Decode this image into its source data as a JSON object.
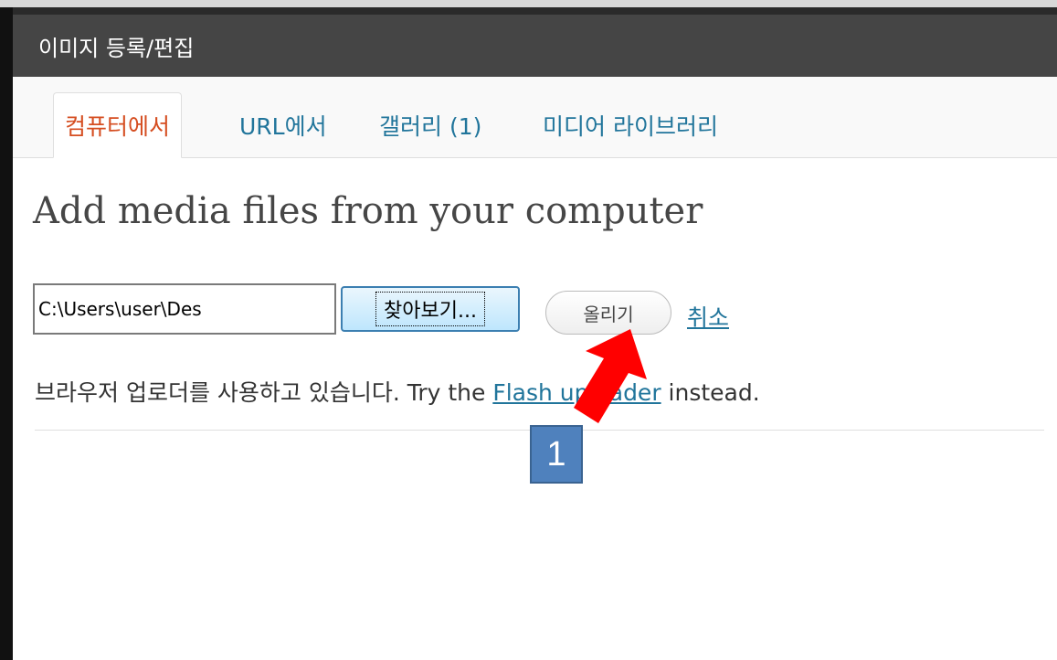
{
  "dialog": {
    "title": "이미지 등록/편집"
  },
  "tabs": [
    {
      "label": "컴퓨터에서",
      "active": true
    },
    {
      "label": "URL에서"
    },
    {
      "label": "갤러리 (1)"
    },
    {
      "label": "미디어 라이브러리"
    }
  ],
  "main": {
    "heading": "Add media files from your computer",
    "file_path": "C:\\Users\\user\\Des",
    "browse_label": "찾아보기...",
    "upload_label": "올리기",
    "cancel_label": "취소",
    "info_prefix": "브라우저 업로더를 사용하고 있습니다. Try the ",
    "info_link": "Flash uploader",
    "info_suffix": " instead."
  },
  "annotation": {
    "badge_number": "1",
    "arrow_color": "#ff0000",
    "badge_color": "#4f81bd"
  }
}
